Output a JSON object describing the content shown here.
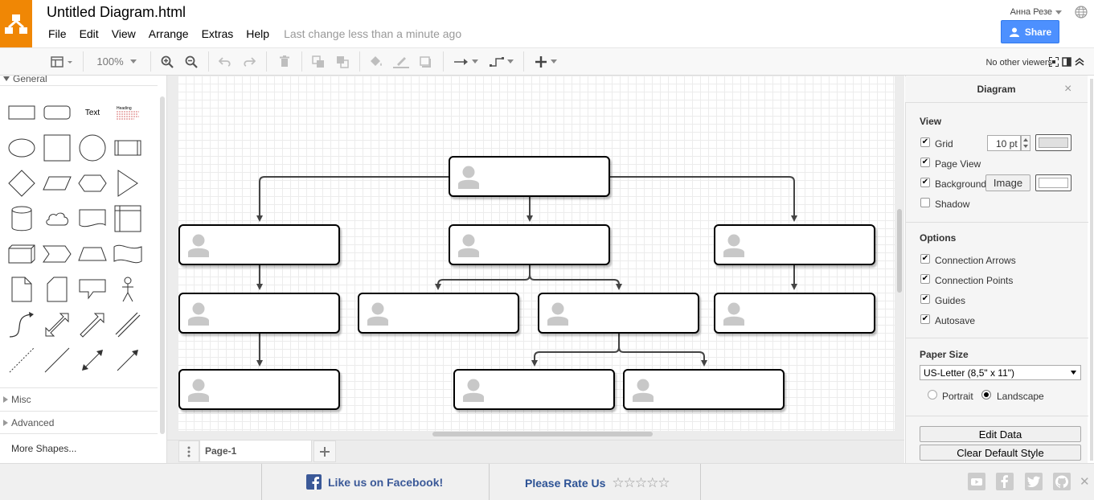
{
  "app": {
    "title": "Untitled Diagram.html",
    "last_change": "Last change less than a minute ago",
    "user": "Анна Резе",
    "share_label": "Share",
    "brand_color": "#f08705",
    "share_color": "#4d90fe"
  },
  "menu": [
    "File",
    "Edit",
    "View",
    "Arrange",
    "Extras",
    "Help"
  ],
  "toolbar": {
    "zoom": "100%",
    "viewers": "No other viewers",
    "icons": [
      "format-panel-icon",
      "zoom-in-icon",
      "zoom-out-icon",
      "undo-icon",
      "redo-icon",
      "delete-icon",
      "to-front-icon",
      "to-back-icon",
      "fill-color-icon",
      "line-color-icon",
      "shadow-icon",
      "connection-icon",
      "waypoints-icon",
      "insert-icon",
      "fullscreen-icon",
      "collapse-icon"
    ]
  },
  "sidebar": {
    "general": "General",
    "text_shape": "Text",
    "heading_shape": "Heading",
    "misc": "Misc",
    "advanced": "Advanced",
    "more_shapes": "More Shapes..."
  },
  "tabs": {
    "page": "Page-1"
  },
  "format": {
    "title": "Diagram",
    "view_header": "View",
    "grid": "Grid",
    "grid_size": "10 pt",
    "page_view": "Page View",
    "background": "Background",
    "image_btn": "Image",
    "shadow": "Shadow",
    "options_header": "Options",
    "options": [
      "Connection Arrows",
      "Connection Points",
      "Guides",
      "Autosave"
    ],
    "paper_header": "Paper Size",
    "paper_value": "US-Letter (8,5\" x 11\")",
    "portrait": "Portrait",
    "landscape": "Landscape",
    "edit_data": "Edit Data",
    "clear_style": "Clear Default Style"
  },
  "footer": {
    "facebook": "Like us on Facebook!",
    "rate": "Please Rate Us",
    "stars": "☆☆☆☆☆",
    "social": [
      "youtube-icon",
      "facebook-icon",
      "twitter-icon",
      "github-icon"
    ]
  }
}
